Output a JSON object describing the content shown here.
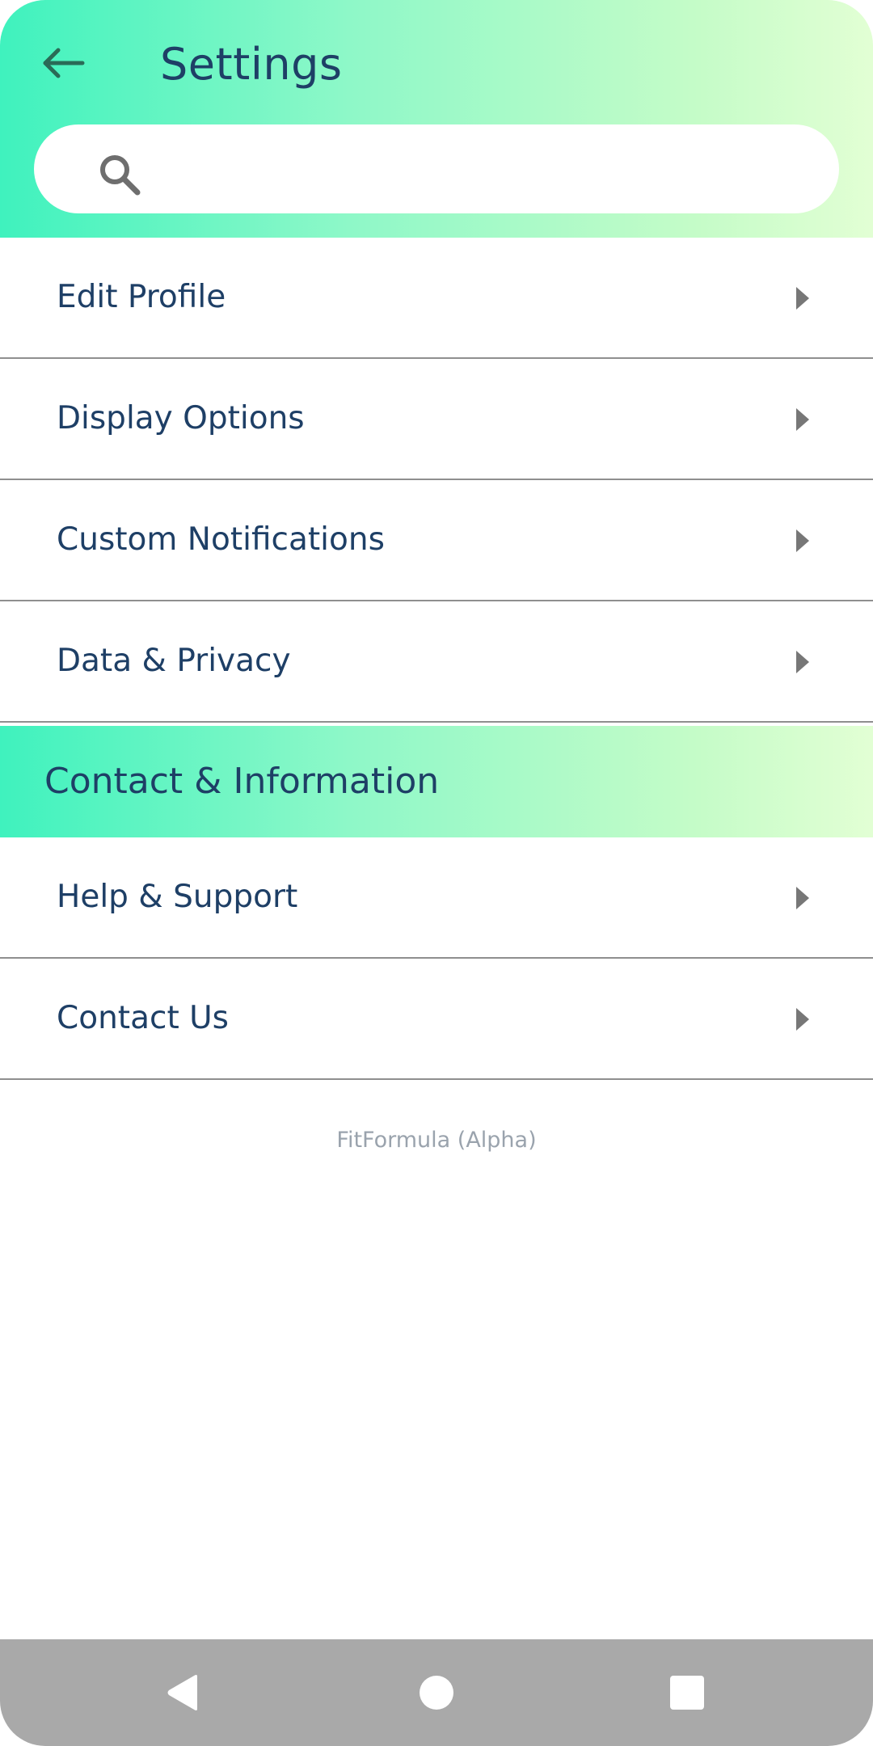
{
  "header": {
    "title": "Settings",
    "back_icon": "arrow-left-icon",
    "search": {
      "placeholder": "",
      "value": "",
      "icon": "search-icon"
    },
    "gradient_colors": [
      "#3ff2be",
      "#e2ffd4"
    ]
  },
  "settings_items": [
    {
      "label": "Edit Profile",
      "icon": "chevron-right-icon"
    },
    {
      "label": "Display Options",
      "icon": "chevron-right-icon"
    },
    {
      "label": "Custom Notifications",
      "icon": "chevron-right-icon"
    },
    {
      "label": "Data & Privacy",
      "icon": "chevron-right-icon"
    }
  ],
  "contact_section": {
    "title": "Contact & Information",
    "items": [
      {
        "label": "Help & Support",
        "icon": "chevron-right-icon"
      },
      {
        "label": "Contact Us",
        "icon": "chevron-right-icon"
      }
    ]
  },
  "footer": {
    "app_version": "FitFormula (Alpha)"
  },
  "system_nav": {
    "buttons": [
      "back-triangle-icon",
      "home-circle-icon",
      "recents-square-icon"
    ]
  },
  "colors": {
    "text_primary": "#1e3f66",
    "divider": "#8f8f8f",
    "chevron": "#777777",
    "footer_text": "#9aa3ad",
    "navbar": "#a9a9a9"
  }
}
